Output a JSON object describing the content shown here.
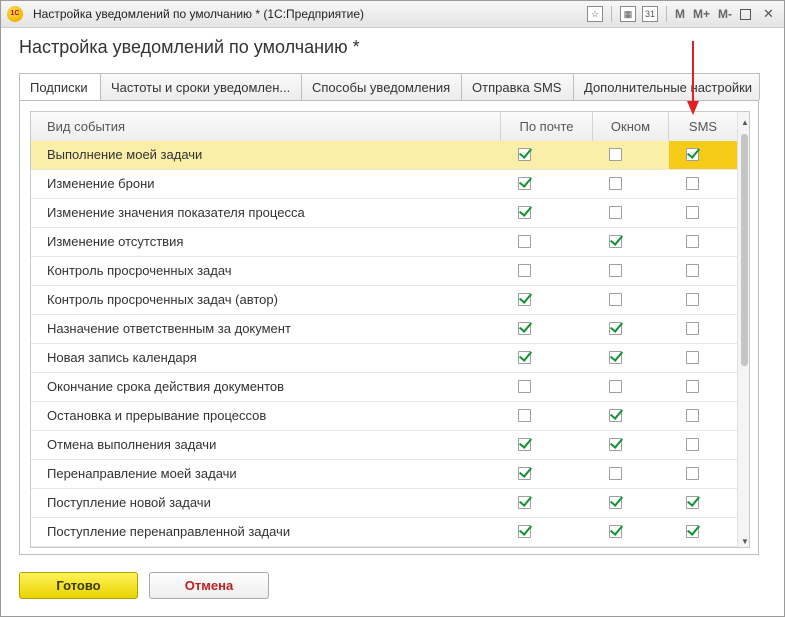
{
  "window": {
    "title": "Настройка уведомлений по умолчанию * (1С:Предприятие)",
    "logo_text": "1C",
    "toolbar": [
      "star-icon",
      "calendar-icon",
      "calculator-icon"
    ],
    "m_buttons": [
      "M",
      "M+",
      "M-"
    ]
  },
  "form": {
    "title": "Настройка уведомлений по умолчанию *"
  },
  "tabs": [
    {
      "label": "Подписки",
      "active": true
    },
    {
      "label": "Частоты и сроки уведомлен..."
    },
    {
      "label": "Способы уведомления"
    },
    {
      "label": "Отправка SMS"
    },
    {
      "label": "Дополнительные настройки"
    }
  ],
  "table": {
    "columns": [
      "Вид события",
      "По почте",
      "Окном",
      "SMS"
    ],
    "rows": [
      {
        "name": "Выполнение моей задачи",
        "email": true,
        "window": false,
        "sms": true,
        "selected": true
      },
      {
        "name": "Изменение брони",
        "email": true,
        "window": false,
        "sms": false
      },
      {
        "name": "Изменение значения показателя процесса",
        "email": true,
        "window": false,
        "sms": false
      },
      {
        "name": "Изменение отсутствия",
        "email": false,
        "window": true,
        "sms": false
      },
      {
        "name": "Контроль просроченных задач",
        "email": false,
        "window": false,
        "sms": false
      },
      {
        "name": "Контроль просроченных задач (автор)",
        "email": true,
        "window": false,
        "sms": false
      },
      {
        "name": "Назначение ответственным за документ",
        "email": true,
        "window": true,
        "sms": false
      },
      {
        "name": "Новая запись календаря",
        "email": true,
        "window": true,
        "sms": false
      },
      {
        "name": "Окончание срока действия документов",
        "email": false,
        "window": false,
        "sms": false
      },
      {
        "name": "Остановка и прерывание процессов",
        "email": false,
        "window": true,
        "sms": false
      },
      {
        "name": "Отмена выполнения задачи",
        "email": true,
        "window": true,
        "sms": false
      },
      {
        "name": "Перенаправление моей задачи",
        "email": true,
        "window": false,
        "sms": false
      },
      {
        "name": "Поступление новой задачи",
        "email": true,
        "window": true,
        "sms": true
      },
      {
        "name": "Поступление перенаправленной задачи",
        "email": true,
        "window": true,
        "sms": true
      }
    ]
  },
  "buttons": {
    "ok": "Готово",
    "cancel": "Отмена"
  },
  "colors": {
    "selected_row": "#faefa8",
    "selected_cell": "#f6cb18",
    "check": "#119233",
    "arrow": "#e02020"
  }
}
